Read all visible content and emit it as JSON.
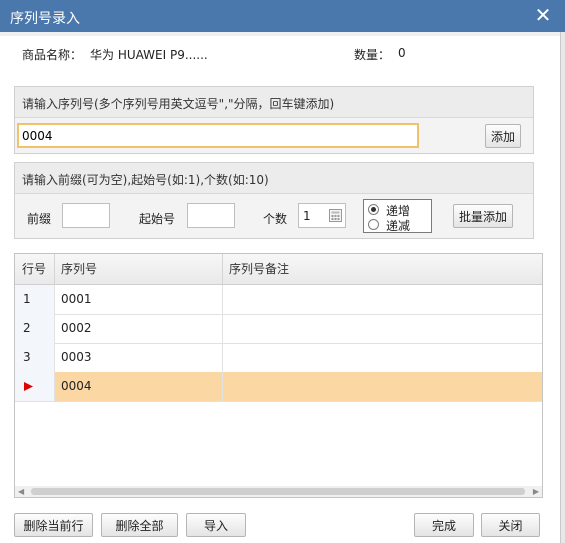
{
  "window": {
    "title": "序列号录入"
  },
  "info": {
    "product_label": "商品名称：",
    "product_value": "华为 HUAWEI P9......",
    "qty_label": "数量：",
    "qty_value": "0"
  },
  "serial_panel": {
    "hint": "请输入序列号(多个序列号用英文逗号\",\"分隔，回车键添加)",
    "input_value": "0004",
    "add_label": "添加"
  },
  "batch_panel": {
    "hint": "请输入前缀(可为空),起始号(如:1),个数(如:10)",
    "prefix_label": "前缀",
    "start_label": "起始号",
    "count_label": "个数",
    "count_value": "1",
    "increase_label": "递增",
    "decrease_label": "递减",
    "batch_add_label": "批量添加"
  },
  "grid": {
    "columns": [
      "行号",
      "序列号",
      "序列号备注"
    ],
    "rows": [
      {
        "num": "1",
        "serial": "0001",
        "note": ""
      },
      {
        "num": "2",
        "serial": "0002",
        "note": ""
      },
      {
        "num": "3",
        "serial": "0003",
        "note": ""
      },
      {
        "num": "",
        "serial": "0004",
        "note": "",
        "current": true
      }
    ]
  },
  "footer": {
    "delete_row": "删除当前行",
    "delete_all": "删除全部",
    "import": "导入",
    "done": "完成",
    "close": "关闭"
  },
  "colors": {
    "title_bar": "#4a78ad",
    "selected_row": "#fbd7a4",
    "current_marker": "#e00000"
  }
}
